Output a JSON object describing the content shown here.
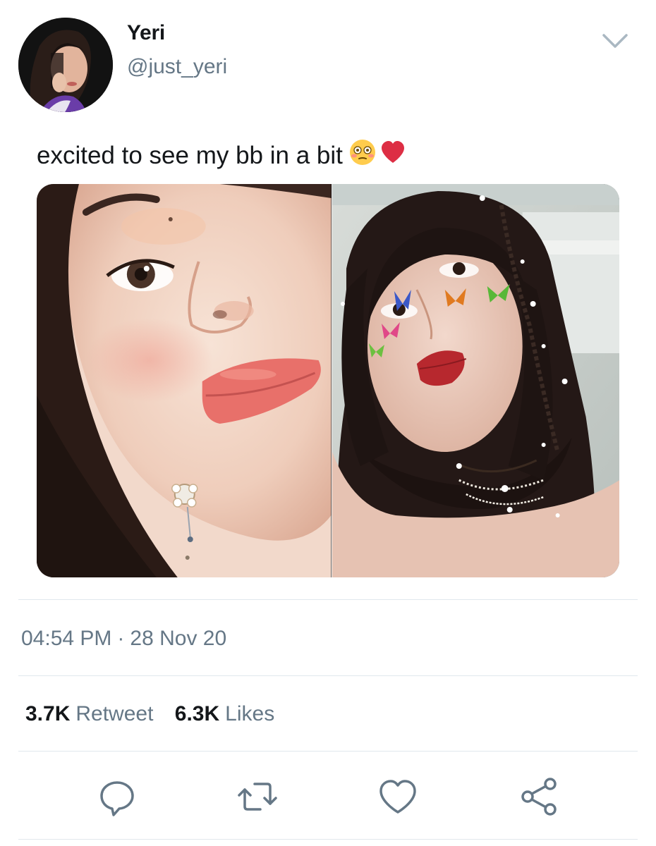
{
  "author": {
    "display_name": "Yeri",
    "handle": "@just_yeri"
  },
  "tweet": {
    "text": "excited to see my bb in a bit",
    "emojis": [
      "flushed-face",
      "red-heart"
    ],
    "time": "04:54 PM",
    "separator": "·",
    "date": "28 Nov 20"
  },
  "stats": {
    "retweets_count": "3.7K",
    "retweets_label": "Retweet",
    "likes_count": "6.3K",
    "likes_label": "Likes"
  },
  "icons": {
    "menu": "chevron-down-icon",
    "reply": "reply-icon",
    "retweet": "retweet-icon",
    "like": "heart-icon",
    "share": "share-icon"
  },
  "colors": {
    "text_primary": "#14171a",
    "text_secondary": "#657786",
    "divider": "#e1e8ed",
    "heart_emoji": "#dd2e44",
    "face_emoji": "#ffcc4d"
  }
}
